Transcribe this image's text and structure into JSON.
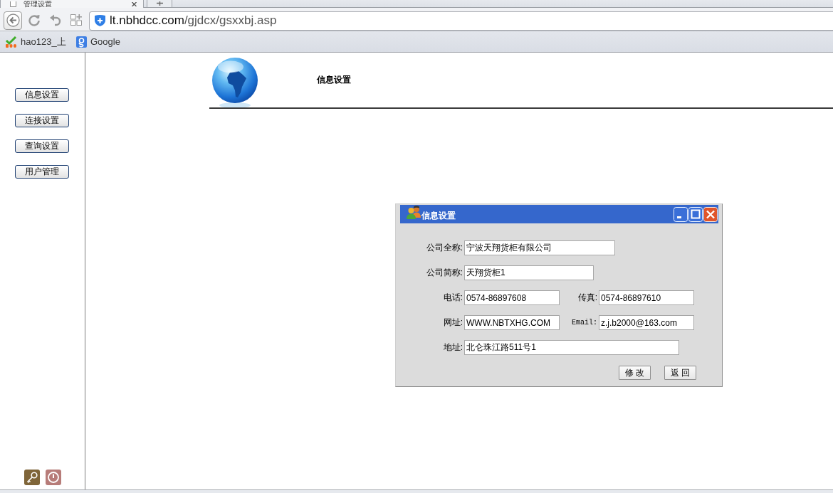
{
  "browser": {
    "tab": {
      "title": "管理设置"
    },
    "address_bar": {
      "host": "lt.nbhdcc.com",
      "path": "/gjdcx/gsxxbj.asp"
    },
    "bookmarks": [
      {
        "label": "hao123_上"
      },
      {
        "label": "Google"
      }
    ]
  },
  "sidebar": {
    "buttons": [
      {
        "label": "信息设置"
      },
      {
        "label": "连接设置"
      },
      {
        "label": "查询设置"
      },
      {
        "label": "用户管理"
      }
    ]
  },
  "header": {
    "title": "信息设置"
  },
  "dialog": {
    "title": "信息设置",
    "rows": [
      [
        {
          "label": "公司全称:",
          "value": "宁波天翔货柜有限公司"
        }
      ],
      [
        {
          "label": "公司简称:",
          "value": "天翔货柜1"
        }
      ],
      [
        {
          "label": "电话:",
          "value": "0574-86897608"
        },
        {
          "label": "传真:",
          "value": "0574-86897610"
        }
      ],
      [
        {
          "label": "网址:",
          "value": "WWW.NBTXHG.COM"
        },
        {
          "label": "Email:",
          "value": "z.j.b2000@163.com"
        }
      ],
      [
        {
          "label": "地址:",
          "value": "北仑珠江路511号1"
        }
      ]
    ],
    "buttons": [
      "修 改",
      "返 回"
    ]
  }
}
